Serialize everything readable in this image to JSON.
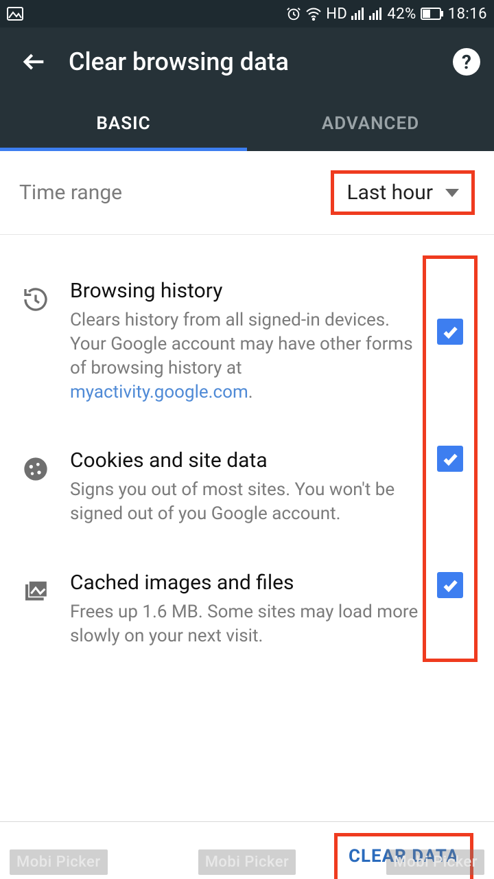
{
  "statusbar": {
    "battery_percent": "42%",
    "time": "18:16",
    "hd_label": "HD"
  },
  "header": {
    "title": "Clear browsing data"
  },
  "tabs": {
    "basic": "BASIC",
    "advanced": "ADVANCED"
  },
  "time_range": {
    "label": "Time range",
    "value": "Last hour"
  },
  "options": [
    {
      "title": "Browsing history",
      "desc_before": "Clears history from all signed-in devices. Your Google account may have other forms of browsing history at ",
      "link": "myactivity.google.com",
      "desc_after": "."
    },
    {
      "title": "Cookies and site data",
      "desc": "Signs you out of most sites. You won't be signed out of you Google account."
    },
    {
      "title": "Cached images and files",
      "desc": "Frees up 1.6 MB. Some sites may load more slowly on your next visit."
    }
  ],
  "footer": {
    "clear": "CLEAR DATA"
  },
  "watermark": {
    "text": "Mobi Picker"
  }
}
